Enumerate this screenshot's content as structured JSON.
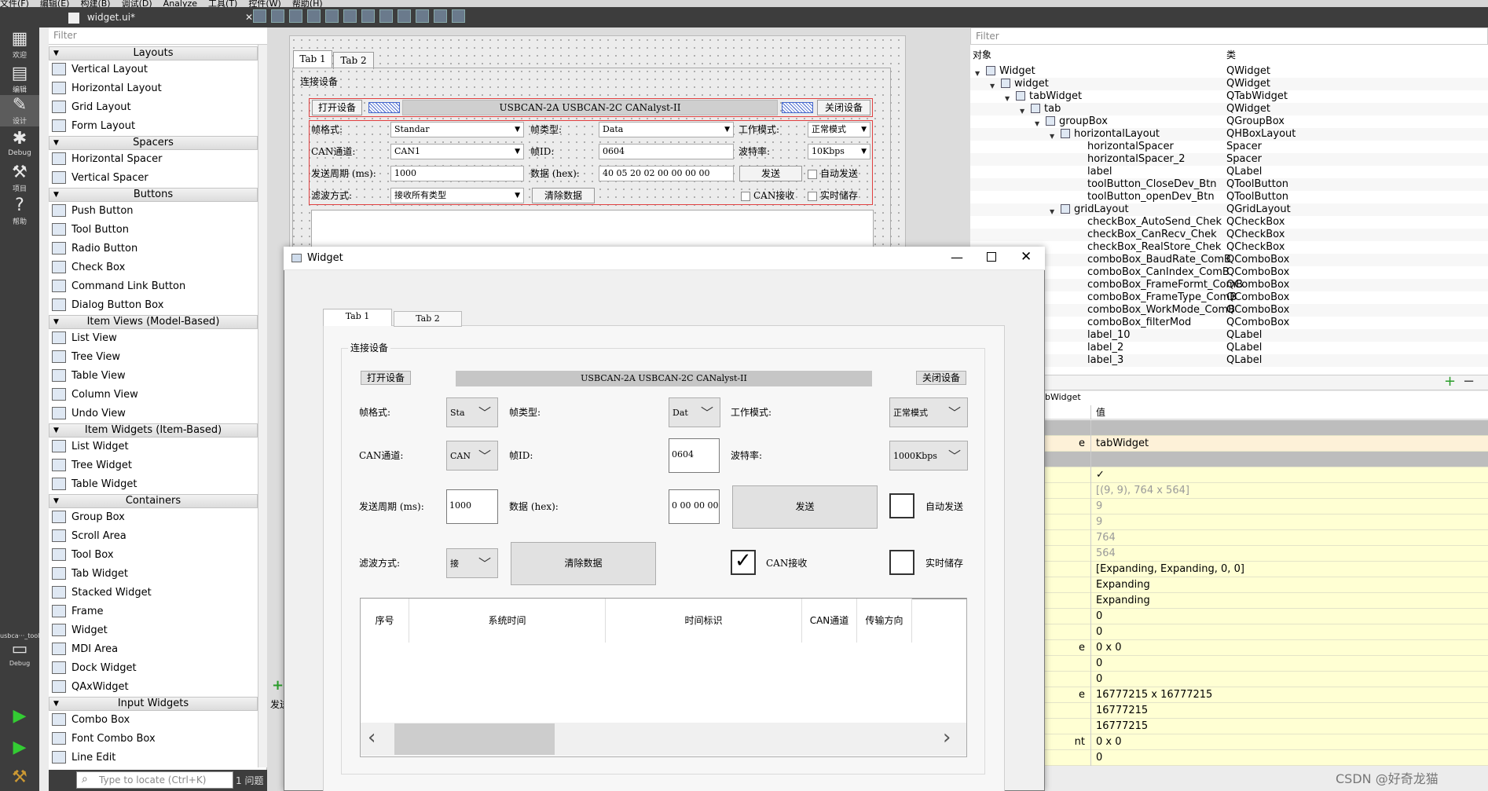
{
  "menubar": {
    "items": [
      "文件(F)",
      "编辑(E)",
      "构建(B)",
      "调试(D)",
      "Analyze",
      "工具(T)",
      "控件(W)",
      "帮助(H)"
    ]
  },
  "modes": [
    {
      "icon": "grid-icon",
      "label": "欢迎"
    },
    {
      "icon": "document-icon",
      "label": "编辑"
    },
    {
      "icon": "pencil-icon",
      "label": "设计"
    },
    {
      "icon": "bug-icon",
      "label": "Debug"
    },
    {
      "icon": "wrench-icon",
      "label": "项目"
    },
    {
      "icon": "help-icon",
      "label": "帮助"
    }
  ],
  "project_target": {
    "name": "usbca···_tool",
    "mode": "Debug"
  },
  "editor": {
    "file_name": "widget.ui*"
  },
  "widget_box": {
    "filter_placeholder": "Filter",
    "categories": [
      {
        "label": "Layouts",
        "items": [
          "Vertical Layout",
          "Horizontal Layout",
          "Grid Layout",
          "Form Layout"
        ]
      },
      {
        "label": "Spacers",
        "items": [
          "Horizontal Spacer",
          "Vertical Spacer"
        ]
      },
      {
        "label": "Buttons",
        "items": [
          "Push Button",
          "Tool Button",
          "Radio Button",
          "Check Box",
          "Command Link Button",
          "Dialog Button Box"
        ]
      },
      {
        "label": "Item Views (Model-Based)",
        "items": [
          "List View",
          "Tree View",
          "Table View",
          "Column View",
          "Undo View"
        ]
      },
      {
        "label": "Item Widgets (Item-Based)",
        "items": [
          "List Widget",
          "Tree Widget",
          "Table Widget"
        ]
      },
      {
        "label": "Containers",
        "items": [
          "Group Box",
          "Scroll Area",
          "Tool Box",
          "Tab Widget",
          "Stacked Widget",
          "Frame",
          "Widget",
          "MDI Area",
          "Dock Widget",
          "QAxWidget"
        ]
      },
      {
        "label": "Input Widgets",
        "items": [
          "Combo Box",
          "Font Combo Box",
          "Line Edit"
        ]
      }
    ]
  },
  "locator": {
    "placeholder": "Type to locate (Ctrl+K)",
    "issues": "1 问题"
  },
  "designer_form": {
    "tabs": [
      "Tab 1",
      "Tab 2"
    ],
    "group_title": "连接设备",
    "open_btn": "打开设备",
    "device_label": "USBCAN-2A  USBCAN-2C  CANalyst-II",
    "close_btn": "关闭设备",
    "frame_format_label": "帧格式:",
    "frame_format_value": "Standar",
    "frame_type_label": "帧类型:",
    "frame_type_value": "Data",
    "work_mode_label": "工作模式:",
    "work_mode_value": "正常模式",
    "can_channel_label": "CAN通道:",
    "can_channel_value": "CAN1",
    "frame_id_label": "帧ID:",
    "frame_id_value": "0604",
    "baud_label": "波特率:",
    "baud_value": "10Kbps",
    "period_label": "发送周期 (ms):",
    "period_value": "1000",
    "data_label": "数据 (hex):",
    "data_value": "40 05 20 02 00 00 00 00",
    "send_btn": "发送",
    "auto_send": "自动发送",
    "filter_label": "滤波方式:",
    "filter_value": "接收所有类型",
    "clear_btn": "清除数据",
    "can_recv": "CAN接收",
    "realtime_store": "实时储存",
    "bottom_label": "发送"
  },
  "object_inspector": {
    "filter_placeholder": "Filter",
    "col_object": "对象",
    "col_class": "类",
    "rows": [
      {
        "name": "Widget",
        "cls": "QWidget",
        "indent": 0,
        "expand": true,
        "icon": true
      },
      {
        "name": "widget",
        "cls": "QWidget",
        "indent": 1,
        "expand": true,
        "icon": true
      },
      {
        "name": "tabWidget",
        "cls": "QTabWidget",
        "indent": 2,
        "expand": true,
        "icon": true
      },
      {
        "name": "tab",
        "cls": "QWidget",
        "indent": 3,
        "expand": true,
        "icon": true
      },
      {
        "name": "groupBox",
        "cls": "QGroupBox",
        "indent": 4,
        "expand": true,
        "icon": true
      },
      {
        "name": "horizontalLayout",
        "cls": "QHBoxLayout",
        "indent": 5,
        "expand": true,
        "icon": true
      },
      {
        "name": "horizontalSpacer",
        "cls": "Spacer",
        "indent": 6,
        "expand": false,
        "icon": false
      },
      {
        "name": "horizontalSpacer_2",
        "cls": "Spacer",
        "indent": 6,
        "expand": false,
        "icon": false
      },
      {
        "name": "label",
        "cls": "QLabel",
        "indent": 6,
        "expand": false,
        "icon": false
      },
      {
        "name": "toolButton_CloseDev_Btn",
        "cls": "QToolButton",
        "indent": 6,
        "expand": false,
        "icon": false
      },
      {
        "name": "toolButton_openDev_Btn",
        "cls": "QToolButton",
        "indent": 6,
        "expand": false,
        "icon": false
      },
      {
        "name": "gridLayout",
        "cls": "QGridLayout",
        "indent": 5,
        "expand": true,
        "icon": true
      },
      {
        "name": "checkBox_AutoSend_Chek",
        "cls": "QCheckBox",
        "indent": 6,
        "expand": false,
        "icon": false
      },
      {
        "name": "checkBox_CanRecv_Chek",
        "cls": "QCheckBox",
        "indent": 6,
        "expand": false,
        "icon": false
      },
      {
        "name": "checkBox_RealStore_Chek",
        "cls": "QCheckBox",
        "indent": 6,
        "expand": false,
        "icon": false
      },
      {
        "name": "comboBox_BaudRate_ComB",
        "cls": "QComboBox",
        "indent": 6,
        "expand": false,
        "icon": false
      },
      {
        "name": "comboBox_CanIndex_ComB",
        "cls": "QComboBox",
        "indent": 6,
        "expand": false,
        "icon": false
      },
      {
        "name": "comboBox_FrameFormt_ComB",
        "cls": "QComboBox",
        "indent": 6,
        "expand": false,
        "icon": false
      },
      {
        "name": "comboBox_FrameType_ComB",
        "cls": "QComboBox",
        "indent": 6,
        "expand": false,
        "icon": false
      },
      {
        "name": "comboBox_WorkMode_ComB",
        "cls": "QComboBox",
        "indent": 6,
        "expand": false,
        "icon": false
      },
      {
        "name": "comboBox_filterMod",
        "cls": "QComboBox",
        "indent": 6,
        "expand": false,
        "icon": false
      },
      {
        "name": "label_10",
        "cls": "QLabel",
        "indent": 6,
        "expand": false,
        "icon": false
      },
      {
        "name": "label_2",
        "cls": "QLabel",
        "indent": 6,
        "expand": false,
        "icon": false
      },
      {
        "name": "label_3",
        "cls": "QLabel",
        "indent": 6,
        "expand": false,
        "icon": false
      }
    ]
  },
  "property_editor": {
    "class_label": "bWidget",
    "col_value": "值",
    "rows": [
      {
        "n": "",
        "v": "",
        "style": "section"
      },
      {
        "n": "e",
        "v": "tabWidget",
        "style": "cream"
      },
      {
        "n": "",
        "v": "",
        "style": "section"
      },
      {
        "n": "",
        "v": "✓",
        "style": "yellow"
      },
      {
        "n": "",
        "v": "[(9, 9), 764 x 564]",
        "style": "yellow-grey"
      },
      {
        "n": "",
        "v": "9",
        "style": "yellow-grey"
      },
      {
        "n": "",
        "v": "9",
        "style": "yellow-grey"
      },
      {
        "n": "",
        "v": "764",
        "style": "yellow-grey"
      },
      {
        "n": "",
        "v": "564",
        "style": "yellow-grey"
      },
      {
        "n": "",
        "v": "[Expanding, Expanding, 0, 0]",
        "style": "yellow"
      },
      {
        "n": "",
        "v": "Expanding",
        "style": "yellow"
      },
      {
        "n": "",
        "v": "Expanding",
        "style": "yellow"
      },
      {
        "n": "",
        "v": "0",
        "style": "yellow"
      },
      {
        "n": "",
        "v": "0",
        "style": "yellow"
      },
      {
        "n": "e",
        "v": "0 x 0",
        "style": "yellow"
      },
      {
        "n": "",
        "v": "0",
        "style": "yellow"
      },
      {
        "n": "",
        "v": "0",
        "style": "yellow"
      },
      {
        "n": "e",
        "v": "16777215 x 16777215",
        "style": "yellow"
      },
      {
        "n": "",
        "v": "16777215",
        "style": "yellow"
      },
      {
        "n": "",
        "v": "16777215",
        "style": "yellow"
      },
      {
        "n": "nt",
        "v": "0 x 0",
        "style": "yellow"
      },
      {
        "n": "",
        "v": "0",
        "style": "yellow"
      }
    ]
  },
  "preview_window": {
    "title": "Widget",
    "tabs": [
      "Tab 1",
      "Tab 2"
    ],
    "group_title": "连接设备",
    "open_btn": "打开设备",
    "device_label": "USBCAN-2A  USBCAN-2C  CANalyst-II",
    "close_btn": "关闭设备",
    "frame_format_label": "帧格式:",
    "frame_format_value": "Sta",
    "frame_type_label": "帧类型:",
    "frame_type_value": "Dat",
    "work_mode_label": "工作模式:",
    "work_mode_value": "正常模式",
    "can_channel_label": "CAN通道:",
    "can_channel_value": "CAN",
    "frame_id_label": "帧ID:",
    "frame_id_value": "0604",
    "baud_label": "波特率:",
    "baud_value": "1000Kbps",
    "period_label": "发送周期 (ms):",
    "period_value": "1000",
    "data_label": "数据 (hex):",
    "data_value": "0 00 00 00",
    "send_btn": "发送",
    "auto_send": "自动发送",
    "filter_label": "滤波方式:",
    "filter_value": "接",
    "clear_btn": "清除数据",
    "can_recv": "CAN接收",
    "can_recv_checked": true,
    "realtime_store": "实时储存",
    "table_headers": [
      "序号",
      "系统时间",
      "时间标识",
      "CAN通道",
      "传输方向"
    ]
  },
  "watermark": "CSDN @好奇龙猫"
}
